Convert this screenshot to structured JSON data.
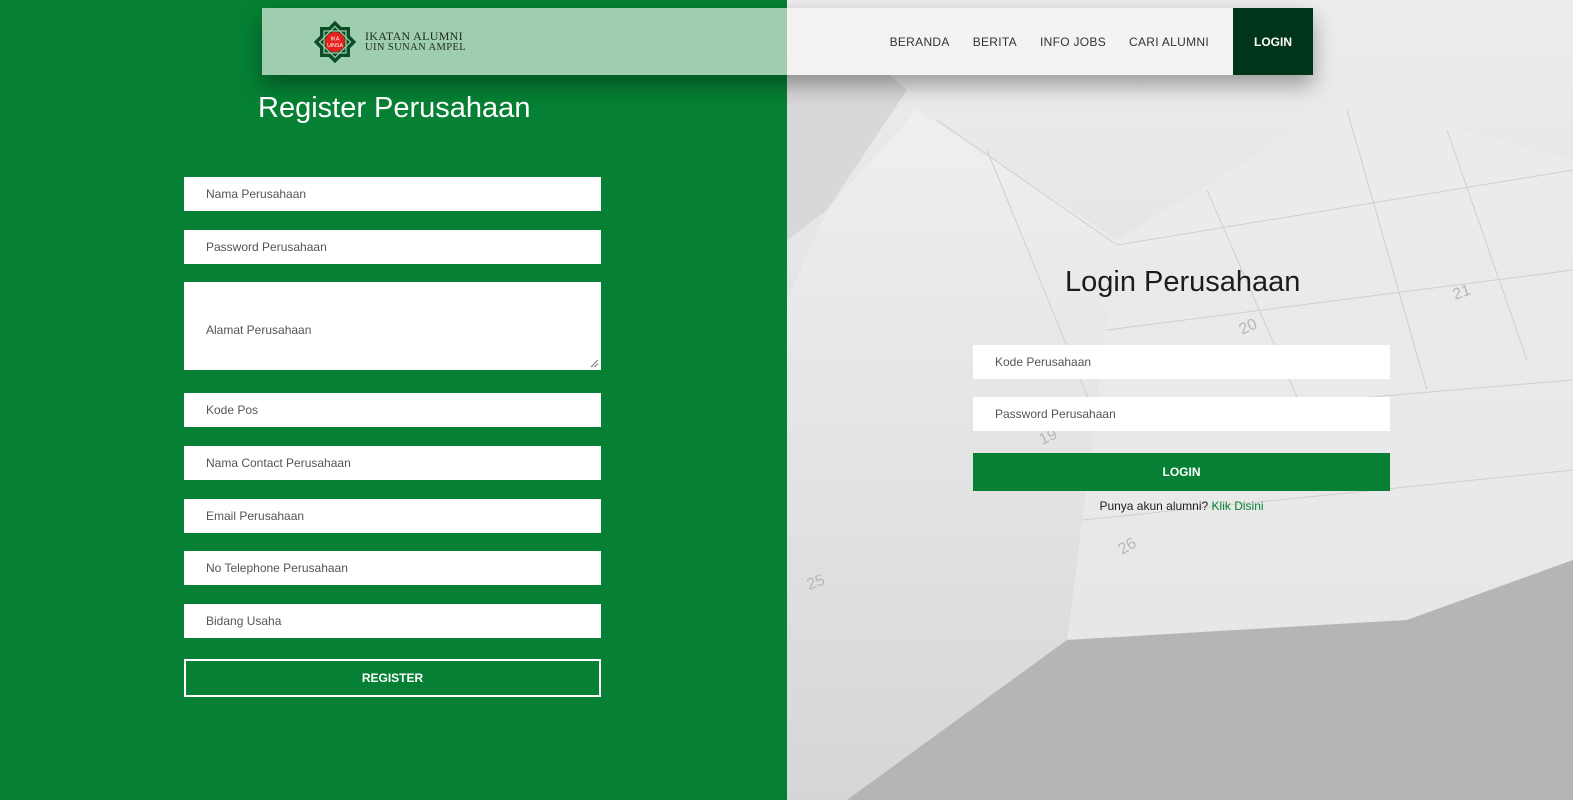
{
  "brand": {
    "badge_line1": "IKA",
    "badge_line2": "UINSA",
    "name_line1": "IKATAN ALUMNI",
    "name_line2": "UIN SUNAN AMPEL"
  },
  "nav": {
    "items": [
      {
        "label": "BERANDA"
      },
      {
        "label": "BERITA"
      },
      {
        "label": "INFO JOBS"
      },
      {
        "label": "CARI ALUMNI"
      }
    ],
    "login_label": "LOGIN"
  },
  "register": {
    "title": "Register Perusahaan",
    "fields": {
      "nama": "Nama Perusahaan",
      "password": "Password Perusahaan",
      "alamat": "Alamat Perusahaan",
      "kode_pos": "Kode Pos",
      "contact": "Nama Contact Perusahaan",
      "email": "Email Perusahaan",
      "telephone": "No Telephone Perusahaan",
      "bidang": "Bidang Usaha"
    },
    "submit_label": "REGISTER"
  },
  "login": {
    "title": "Login Perusahaan",
    "fields": {
      "kode": "Kode Perusahaan",
      "password": "Password Perusahaan"
    },
    "submit_label": "LOGIN",
    "alumni_prompt": "Punya akun alumni?",
    "alumni_link": "Klik Disini"
  },
  "background": {
    "calendar_numbers": [
      "19",
      "20",
      "21",
      "25",
      "26"
    ]
  },
  "colors": {
    "primary_green": "#058034",
    "dark_green": "#003519",
    "header_light_green": "#9ecdb0",
    "logo_red": "#e8211c"
  },
  "icons": {
    "logo": "ika-uinsa-logo-icon",
    "textarea_resize": "resize-grip-icon"
  }
}
